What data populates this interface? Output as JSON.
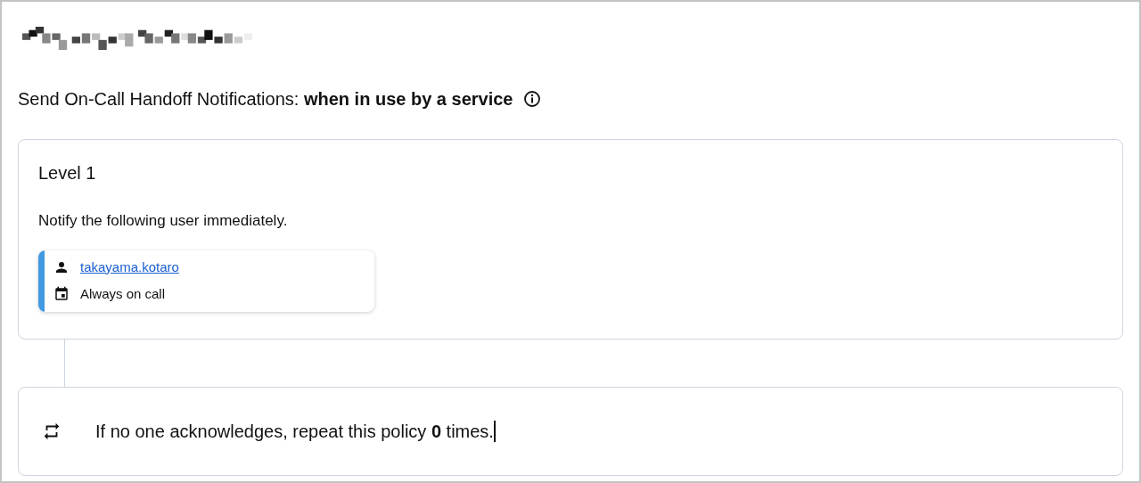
{
  "handoff_notifications": {
    "label": "Send On-Call Handoff Notifications:",
    "value": "when in use by a service"
  },
  "levels": [
    {
      "title": "Level 1",
      "description": "Notify the following user immediately.",
      "targets": [
        {
          "user": "takayama.kotaro",
          "schedule": "Always on call",
          "color": "#4299e1"
        }
      ]
    }
  ],
  "repeat": {
    "text": "If no one acknowledges, repeat this policy **0** times."
  }
}
